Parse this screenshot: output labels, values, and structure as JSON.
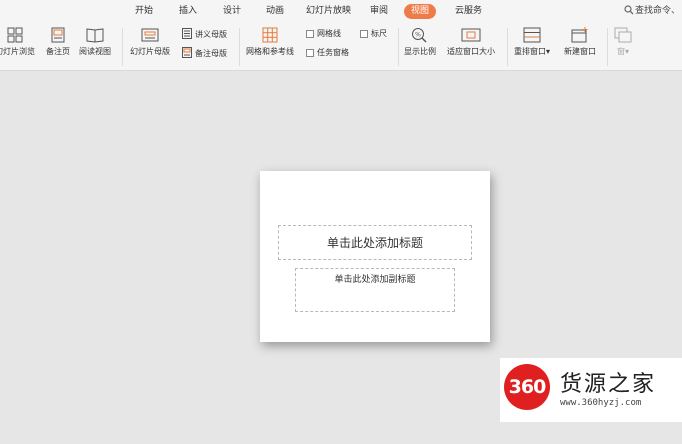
{
  "menu": {
    "tabs": [
      {
        "label": "开始"
      },
      {
        "label": "插入"
      },
      {
        "label": "设计"
      },
      {
        "label": "动画"
      },
      {
        "label": "幻灯片放映"
      },
      {
        "label": "审阅"
      },
      {
        "label": "视图"
      },
      {
        "label": "云服务"
      }
    ],
    "active_tab": "视图",
    "search_label": "查找命令、"
  },
  "ribbon": {
    "slide_browse": "幻灯片浏览",
    "notes_page": "备注页",
    "reading_view": "阅读视图",
    "slide_master": "幻灯片母版",
    "handout_master": "讲义母版",
    "notes_master": "备注母版",
    "grid_guides": "网格和参考线",
    "gridlines": "网格线",
    "ruler": "标尺",
    "task_pane": "任务窗格",
    "zoom": "显示比例",
    "fit_window": "适应窗口大小",
    "rearrange_window": "重排窗口",
    "new_window": "新建窗口",
    "switch_window": "窗"
  },
  "slide": {
    "title_placeholder": "单击此处添加标题",
    "subtitle_placeholder": "单击此处添加副标题"
  },
  "watermark": {
    "logo_number": "360",
    "brand_text": "货源之家",
    "url": "www.360hyzj.com"
  },
  "colors": {
    "accent": "#ee7b4a",
    "logo_red": "#e02020",
    "workspace": "#e6e6e6"
  }
}
